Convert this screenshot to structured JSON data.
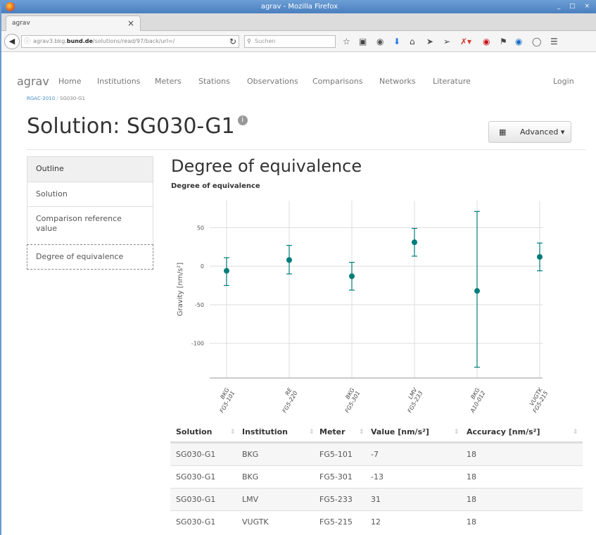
{
  "window": {
    "title": "agrav - Mozilla Firefox",
    "controls": "_ □ ×"
  },
  "browser": {
    "tab_title": "agrav",
    "tab_close": "×",
    "new_tab": "+",
    "url_prefix": "agrav3.bkg.",
    "url_domain": "bund.de",
    "url_path": "/solutions/read/97/back/url=/",
    "search_placeholder": "Suchen"
  },
  "site_nav": {
    "brand": "agrav",
    "links": [
      "Home",
      "Institutions",
      "Meters",
      "Stations",
      "Observations",
      "Comparisons",
      "Networks",
      "Literature"
    ],
    "login": "Login"
  },
  "breadcrumb": {
    "parent": "RGAC-2010",
    "separator": "/",
    "current": "SG030-G1"
  },
  "page": {
    "title": "Solution: SG030-G1",
    "info_icon": "i",
    "advanced_label": "Advanced ▾"
  },
  "sidebar": {
    "items": [
      {
        "label": "Outline"
      },
      {
        "label": "Solution"
      },
      {
        "label": "Comparison reference value"
      },
      {
        "label": "Degree of equivalence"
      }
    ]
  },
  "section": {
    "heading": "Degree of equivalence"
  },
  "chart_data": {
    "type": "scatter",
    "title": "Degree of equivalence",
    "ylabel": "Gravity [nm/s²]",
    "xlabel": "",
    "ylim": [
      -145,
      85
    ],
    "yticks": [
      50,
      0,
      -50,
      -100
    ],
    "grid": true,
    "categories": [
      {
        "inst": "BKG",
        "meter": "FG5-101"
      },
      {
        "inst": "RE",
        "meter": "FG5-220"
      },
      {
        "inst": "BKG",
        "meter": "FG5-301"
      },
      {
        "inst": "LMV",
        "meter": "FG5-233"
      },
      {
        "inst": "BKG",
        "meter": "A10-012"
      },
      {
        "inst": "VUGTK",
        "meter": "FG5-215"
      }
    ],
    "values": [
      -6,
      8,
      -13,
      31,
      -32,
      12
    ],
    "error_low": [
      -25,
      -10,
      -31,
      13,
      -131,
      -6
    ],
    "error_high": [
      11,
      27,
      5,
      49,
      71,
      30
    ],
    "color": "#007b7b"
  },
  "table": {
    "columns": [
      "Solution",
      "Institution",
      "Meter",
      "Value [nm/s²]",
      "Accuracy [nm/s²]"
    ],
    "rows": [
      [
        "SG030-G1",
        "BKG",
        "FG5-101",
        "-7",
        "18"
      ],
      [
        "SG030-G1",
        "BKG",
        "FG5-301",
        "-13",
        "18"
      ],
      [
        "SG030-G1",
        "LMV",
        "FG5-233",
        "31",
        "18"
      ],
      [
        "SG030-G1",
        "VUGTK",
        "FG5-215",
        "12",
        "18"
      ]
    ]
  }
}
